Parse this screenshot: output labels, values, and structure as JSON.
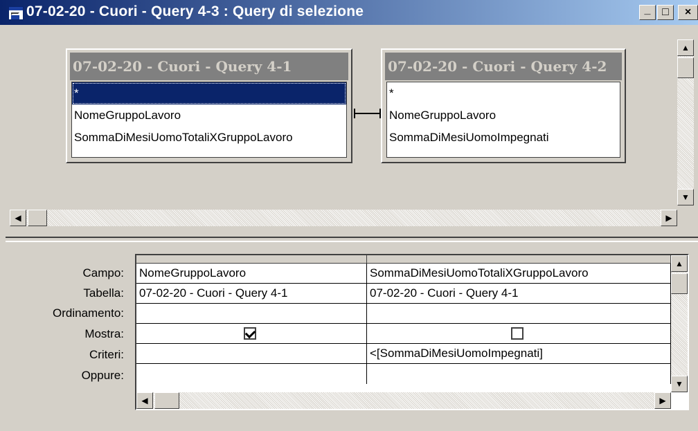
{
  "window": {
    "title": "07-02-20 - Cuori - Query 4-3 : Query di selezione",
    "minimize": "_",
    "maximize": "□",
    "close": "×"
  },
  "tables": [
    {
      "title": "07-02-20 - Cuori - Query 4-1",
      "fields": [
        "*",
        "NomeGruppoLavoro",
        "SommaDiMesiUomoTotaliXGruppoLavoro"
      ]
    },
    {
      "title": "07-02-20 - Cuori - Query 4-2",
      "fields": [
        "*",
        "NomeGruppoLavoro",
        "SommaDiMesiUomoImpegnati"
      ]
    }
  ],
  "grid": {
    "row_labels": {
      "field": "Campo:",
      "table": "Tabella:",
      "sort": "Ordinamento:",
      "show": "Mostra:",
      "criteria": "Criteri:",
      "or": "Oppure:"
    },
    "columns": [
      {
        "field": "NomeGruppoLavoro",
        "table": "07-02-20 - Cuori - Query 4-1",
        "sort": "",
        "show": true,
        "criteria": "",
        "or": ""
      },
      {
        "field": "SommaDiMesiUomoTotaliXGruppoLavoro",
        "table": "07-02-20 - Cuori - Query 4-1",
        "sort": "",
        "show": false,
        "criteria": "<[SommaDiMesiUomoImpegnati]",
        "or": ""
      }
    ]
  }
}
